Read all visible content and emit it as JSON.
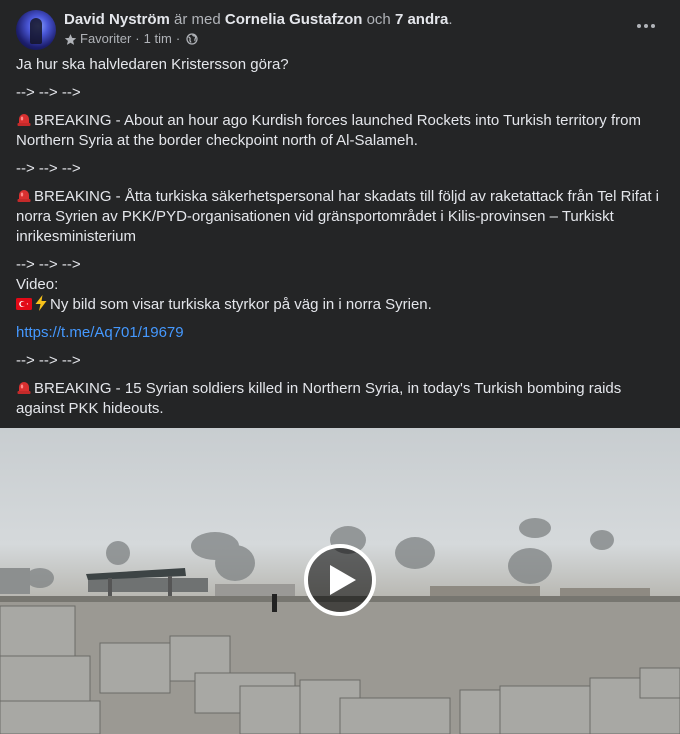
{
  "post": {
    "author": "David Nyström",
    "with_text": "är med",
    "tagged": "Cornelia Gustafzon",
    "and_text": "och",
    "others": "7 andra",
    "period": ".",
    "audience": "Favoriter",
    "separator": "·",
    "time": "1 tim",
    "more_icon": "more-horizontal-icon"
  },
  "body": {
    "line1": "Ja hur ska halvledaren Kristersson göra?",
    "arrows": "--> --> -->",
    "breaking1": "BREAKING - About an hour ago Kurdish forces launched Rockets into Turkish territory from Northern Syria at the border checkpoint north of Al-Salameh.",
    "breaking2": "BREAKING - Åtta turkiska säkerhetspersonal har skadats till följd av raketattack från Tel Rifat i norra Syrien av PKK/PYD-organisationen vid gränsportområdet i Kilis-provinsen – Turkiskt inrikesministerium",
    "video_label": "Video:",
    "video_desc": "Ny bild som visar turkiska styrkor på väg in i norra Syrien.",
    "link": "https://t.me/Aq701/19679",
    "breaking3": "BREAKING - 15 Syrian soldiers killed in Northern Syria, in today's Turkish bombing raids against PKK hideouts."
  },
  "icons": {
    "siren": "police-siren-icon",
    "flag": "turkey-flag-icon",
    "bolt": "lightning-icon",
    "play": "play-icon"
  },
  "colors": {
    "background": "#242526",
    "link": "#4599ff",
    "secondary_text": "#b0b3b8"
  }
}
